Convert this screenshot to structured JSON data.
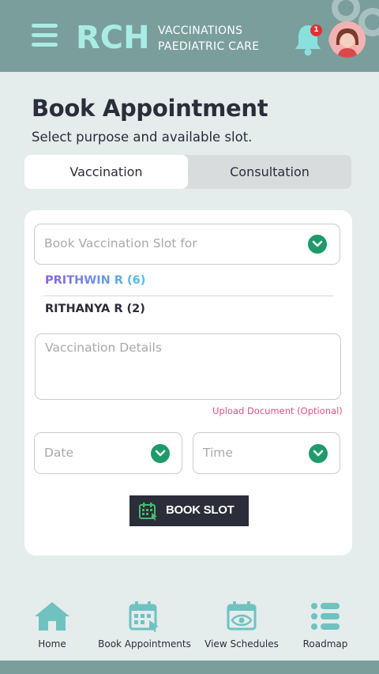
{
  "header": {
    "logo_text": "RCH",
    "brand_line1": "VACCINATIONS",
    "brand_line2": "PAEDIATRIC CARE",
    "notification_count": "1",
    "icons": {
      "menu": "hamburger-menu-icon",
      "bell": "bell-icon",
      "avatar": "user-avatar"
    }
  },
  "page": {
    "title": "Book Appointment",
    "subtitle": "Select purpose and available slot."
  },
  "tabs": [
    {
      "label": "Vaccination",
      "active": true
    },
    {
      "label": "Consultation",
      "active": false
    }
  ],
  "form": {
    "slot_for_placeholder": "Book Vaccination Slot for",
    "children": [
      {
        "name": "PRITHWIN R (6)",
        "selected": true
      },
      {
        "name": "RITHANYA R (2)",
        "selected": false
      }
    ],
    "details_placeholder": "Vaccination Details",
    "upload_label": "Upload Document (Optional)",
    "date_placeholder": "Date",
    "time_placeholder": "Time",
    "submit_label": "BOOK SLOT"
  },
  "bottom_nav": [
    {
      "label": "Home",
      "icon": "home-icon"
    },
    {
      "label": "Book Appointments",
      "icon": "calendar-cursor-icon"
    },
    {
      "label": "View Schedules",
      "icon": "calendar-eye-icon"
    },
    {
      "label": "Roadmap",
      "icon": "list-icon"
    }
  ],
  "colors": {
    "header_bg": "#7a9e9c",
    "page_bg": "#e4ecec",
    "accent_green": "#1f9a6b",
    "nav_icon": "#6fc2c0",
    "link_pink": "#e0507f",
    "button_dark": "#2b2d3a"
  }
}
